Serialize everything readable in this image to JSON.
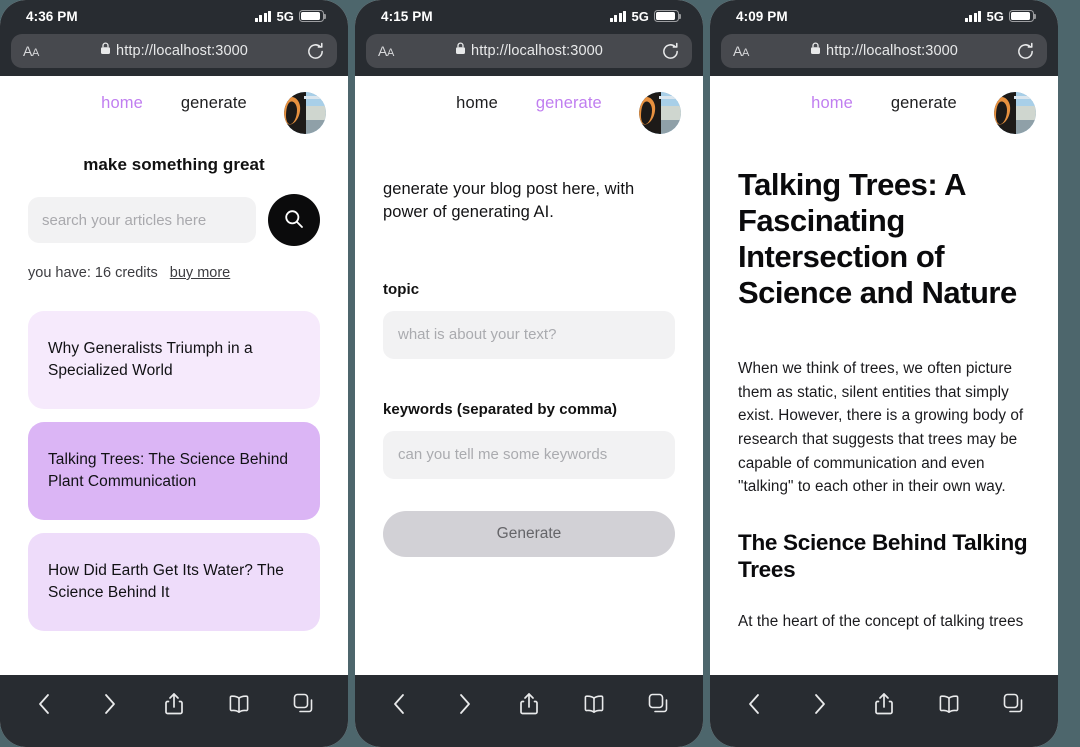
{
  "background_color": "#4d666c",
  "accent_color": "#c07ef0",
  "browser": {
    "aa_label": "AA",
    "url": "http://localhost:3000",
    "network_label": "5G",
    "lock_icon": "lock-icon",
    "reload_icon": "reload-icon",
    "toolbar": {
      "back": "back-icon",
      "forward": "forward-icon",
      "share": "share-icon",
      "bookmarks": "bookmarks-icon",
      "tabs": "tabs-icon"
    }
  },
  "phones": [
    {
      "id": "home",
      "status_time": "4:36 PM",
      "nav": {
        "home_label": "home",
        "generate_label": "generate",
        "active": "home"
      },
      "home": {
        "heading": "make something great",
        "search_placeholder": "search your articles here",
        "search_value": "",
        "search_icon": "search-icon",
        "credits_text": "you have: 16 credits",
        "credits_count": "16",
        "buy_more_label": "buy more",
        "cards": [
          {
            "title": "Why Generalists Triumph in a Specialized World",
            "color": "#f6eafc"
          },
          {
            "title": "Talking Trees: The Science Behind Plant Communication",
            "color": "#dbb5f5"
          },
          {
            "title": "How Did Earth Get Its Water? The Science Behind It",
            "color": "#eedcfa"
          }
        ]
      }
    },
    {
      "id": "generate",
      "status_time": "4:15 PM",
      "nav": {
        "home_label": "home",
        "generate_label": "generate",
        "active": "generate"
      },
      "generate": {
        "intro": "generate your blog post here, with power of generating AI.",
        "topic_label": "topic",
        "topic_placeholder": "what is about your text?",
        "topic_value": "",
        "keywords_label": "keywords (separated by comma)",
        "keywords_placeholder": "can you tell me some keywords",
        "keywords_value": "",
        "submit_label": "Generate"
      }
    },
    {
      "id": "article",
      "status_time": "4:09 PM",
      "nav": {
        "home_label": "home",
        "generate_label": "generate",
        "active": "home"
      },
      "article": {
        "title": "Talking Trees: A Fascinating Intersection of Science and Nature",
        "paragraph_1": "When we think of trees, we often picture them as static, silent entities that simply exist. However, there is a growing body of research that suggests that trees may be capable of communication and even \"talking\" to each other in their own way.",
        "heading_2": "The Science Behind Talking Trees",
        "paragraph_2": "At the heart of the concept of talking trees"
      }
    }
  ]
}
